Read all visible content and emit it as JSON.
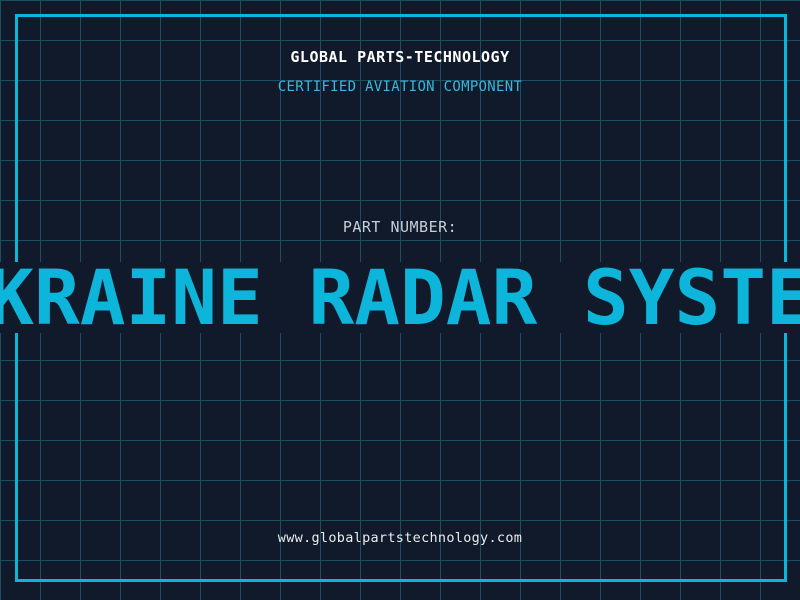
{
  "header": {
    "company": "GLOBAL PARTS-TECHNOLOGY",
    "certification": "CERTIFIED AVIATION COMPONENT"
  },
  "part": {
    "label": "PART NUMBER:",
    "value": "UKRAINE RADAR SYSTEM"
  },
  "footer": {
    "website": "www.globalpartstechnology.com"
  },
  "colors": {
    "background": "#101a2b",
    "grid_line": "#1b5063",
    "accent_cyan": "#0db5db",
    "subtitle_cyan": "#35b9dd",
    "label_gray": "#c7ced6",
    "title_white": "#ffffff",
    "url_white": "#e9eced"
  }
}
